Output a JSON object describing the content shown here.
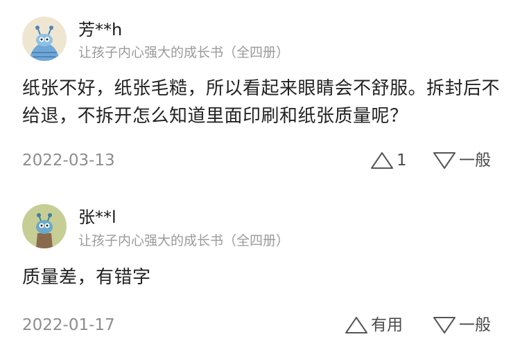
{
  "reviews": [
    {
      "username": "芳**h",
      "product": "让孩子内心强大的成长书（全四册）",
      "content": "纸张不好，纸张毛糙，所以看起来眼睛会不舒服。拆封后不给退，不拆开怎么知道里面印刷和纸张质量呢？",
      "date": "2022-03-13",
      "useful_label": "1",
      "average_label": "一般",
      "avatar_icon": "alien-ufo-avatar-icon"
    },
    {
      "username": "张**l",
      "product": "让孩子内心强大的成长书（全四册）",
      "content": "质量差，有错字",
      "date": "2022-01-17",
      "useful_label": "有用",
      "average_label": "一般",
      "avatar_icon": "alien-mug-avatar-icon"
    }
  ],
  "colors": {
    "text_primary": "#222222",
    "text_secondary": "#9a9a9a",
    "date": "#8c8c8c",
    "icon_stroke": "#555555"
  }
}
